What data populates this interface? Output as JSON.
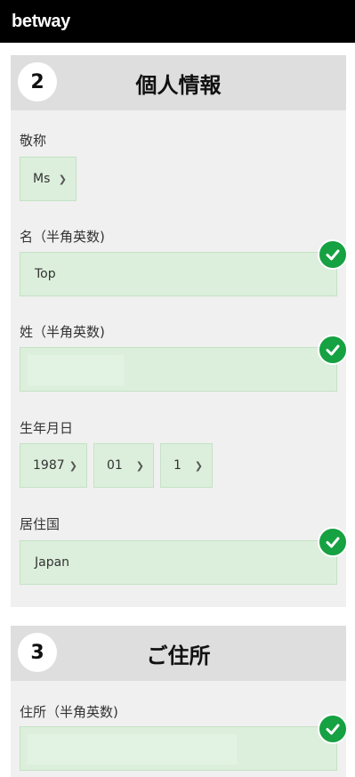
{
  "header": {
    "logo": "betway"
  },
  "section2": {
    "number": "2",
    "title": "個人情報",
    "title_label": "敬称",
    "title_value": "Ms",
    "first_name_label": "名（半角英数)",
    "first_name_value": "Top",
    "last_name_label": "姓（半角英数)",
    "last_name_value": "",
    "dob_label": "生年月日",
    "dob_year": "1987",
    "dob_month": "01",
    "dob_day": "1",
    "country_label": "居住国",
    "country_value": "Japan"
  },
  "section3": {
    "number": "3",
    "title": "ご住所",
    "address_label": "住所（半角英数)",
    "address_value": ""
  },
  "colors": {
    "field_bg": "#dcefdc",
    "check": "#16a142",
    "header_bg": "#000000"
  }
}
